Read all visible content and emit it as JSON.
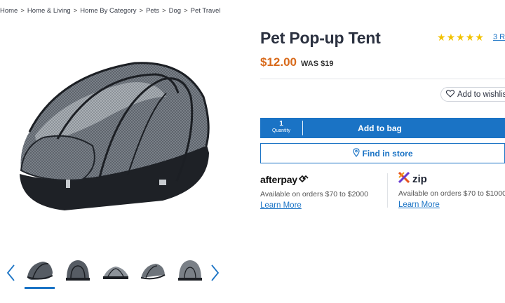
{
  "breadcrumb": [
    "Home",
    "Home & Living",
    "Home By Category",
    "Pets",
    "Dog",
    "Pet Travel"
  ],
  "breadcrumb_separator": ">",
  "product": {
    "title": "Pet Pop-up Tent",
    "rating_stars": 5,
    "reviews_label": "3 R",
    "price": "$12.00",
    "was_price": "WAS $19"
  },
  "wishlist_label": "Add to wishlis",
  "cart": {
    "quantity": "1",
    "quantity_label": "Quantity",
    "add_label": "Add to bag"
  },
  "find_store_label": "Find in store",
  "afterpay": {
    "logo_text": "afterpay",
    "text": "Available on orders $70 to $2000",
    "link": "Learn More"
  },
  "zip": {
    "logo_text": "zip",
    "text": "Available on orders $70 to $1000",
    "link": "Learn More"
  },
  "gallery": {
    "thumbnail_count": 5,
    "selected_index": 0
  },
  "colors": {
    "primary_blue": "#1a73c5",
    "price_orange": "#d86a1b",
    "star_yellow": "#f2c200"
  },
  "icons": [
    "chevron-left-icon",
    "chevron-right-icon",
    "heart-icon",
    "map-pin-icon",
    "afterpay-logo-icon",
    "zip-logo-icon"
  ]
}
